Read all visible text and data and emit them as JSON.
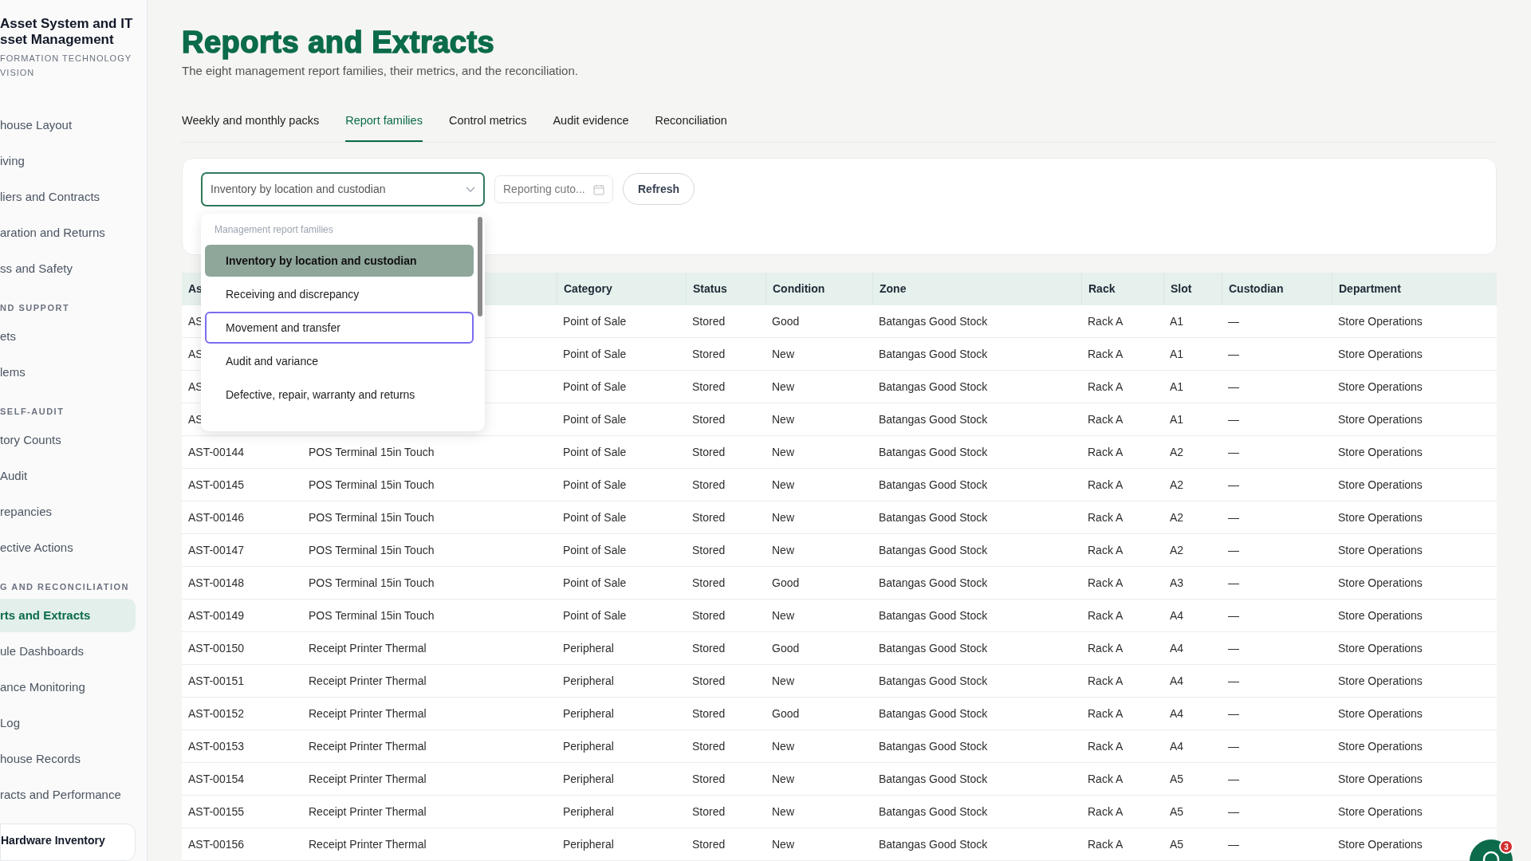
{
  "sidebar": {
    "brand_lines": [
      "Asset System and IT",
      "sset Management"
    ],
    "subtitle_lines": [
      "FORMATION TECHNOLOGY",
      "VISION"
    ],
    "sections": [
      {
        "items": [
          {
            "label": "house Layout",
            "selected": false
          },
          {
            "label": "iving",
            "selected": false
          },
          {
            "label": "liers and Contracts",
            "selected": false
          },
          {
            "label": "aration and Returns",
            "selected": false
          },
          {
            "label": "ss and Safety",
            "selected": false
          }
        ]
      },
      {
        "title": "ND SUPPORT",
        "items": [
          {
            "label": "ets",
            "selected": false
          },
          {
            "label": "lems",
            "selected": false
          }
        ]
      },
      {
        "title": "SELF-AUDIT",
        "items": [
          {
            "label": "tory Counts",
            "selected": false
          },
          {
            "label": "Audit",
            "selected": false
          },
          {
            "label": "repancies",
            "selected": false
          },
          {
            "label": "ective Actions",
            "selected": false
          }
        ]
      },
      {
        "title": "G AND RECONCILIATION",
        "items": [
          {
            "label": "rts and Extracts",
            "selected": true
          },
          {
            "label": "ule Dashboards",
            "selected": false
          },
          {
            "label": "ance Monitoring",
            "selected": false
          },
          {
            "label": "Log",
            "selected": false
          },
          {
            "label": "house Records",
            "selected": false
          },
          {
            "label": "racts and Performance",
            "selected": false
          }
        ]
      }
    ],
    "user_card": {
      "name": "Hardware Inventory"
    }
  },
  "page": {
    "title": "Reports and Extracts",
    "subtitle": "The eight management report families, their metrics, and the reconciliation."
  },
  "tabs": [
    {
      "label": "Weekly and monthly packs",
      "selected": false
    },
    {
      "label": "Report families",
      "selected": true
    },
    {
      "label": "Control metrics",
      "selected": false
    },
    {
      "label": "Audit evidence",
      "selected": false
    },
    {
      "label": "Reconciliation",
      "selected": false
    }
  ],
  "filters": {
    "family_select": {
      "value": "Inventory by location and custodian",
      "open": true
    },
    "date_field": {
      "placeholder": "Reporting cuto..."
    },
    "refresh_button": "Refresh"
  },
  "dropdown": {
    "group_label": "Management report families",
    "options": [
      {
        "label": "Inventory by location and custodian",
        "selected": true,
        "focused": false
      },
      {
        "label": "Receiving and discrepancy",
        "selected": false,
        "focused": false
      },
      {
        "label": "Movement and transfer",
        "selected": false,
        "focused": true
      },
      {
        "label": "Audit and variance",
        "selected": false,
        "focused": false
      },
      {
        "label": "Defective, repair, warranty and returns",
        "selected": false,
        "focused": false
      }
    ]
  },
  "table": {
    "columns": [
      "As",
      "Category",
      "Status",
      "Condition",
      "Zone",
      "Rack",
      "Slot",
      "Custodian",
      "Department"
    ],
    "rows": [
      {
        "asset_id": "AS",
        "category": "Point of Sale",
        "status": "Stored",
        "condition": "Good",
        "zone": "Batangas Good Stock",
        "rack": "Rack A",
        "slot": "A1",
        "custodian": "—",
        "department": "Store Operations"
      },
      {
        "asset_id": "AS",
        "category": "Point of Sale",
        "status": "Stored",
        "condition": "New",
        "zone": "Batangas Good Stock",
        "rack": "Rack A",
        "slot": "A1",
        "custodian": "—",
        "department": "Store Operations"
      },
      {
        "asset_id": "AS",
        "category": "Point of Sale",
        "status": "Stored",
        "condition": "New",
        "zone": "Batangas Good Stock",
        "rack": "Rack A",
        "slot": "A1",
        "custodian": "—",
        "department": "Store Operations"
      },
      {
        "asset_id": "AS",
        "category": "Point of Sale",
        "status": "Stored",
        "condition": "New",
        "zone": "Batangas Good Stock",
        "rack": "Rack A",
        "slot": "A1",
        "custodian": "—",
        "department": "Store Operations"
      },
      {
        "asset_id": "AST-00144",
        "name": "POS Terminal 15in Touch",
        "category": "Point of Sale",
        "status": "Stored",
        "condition": "New",
        "zone": "Batangas Good Stock",
        "rack": "Rack A",
        "slot": "A2",
        "custodian": "—",
        "department": "Store Operations"
      },
      {
        "asset_id": "AST-00145",
        "name": "POS Terminal 15in Touch",
        "category": "Point of Sale",
        "status": "Stored",
        "condition": "New",
        "zone": "Batangas Good Stock",
        "rack": "Rack A",
        "slot": "A2",
        "custodian": "—",
        "department": "Store Operations"
      },
      {
        "asset_id": "AST-00146",
        "name": "POS Terminal 15in Touch",
        "category": "Point of Sale",
        "status": "Stored",
        "condition": "New",
        "zone": "Batangas Good Stock",
        "rack": "Rack A",
        "slot": "A2",
        "custodian": "—",
        "department": "Store Operations"
      },
      {
        "asset_id": "AST-00147",
        "name": "POS Terminal 15in Touch",
        "category": "Point of Sale",
        "status": "Stored",
        "condition": "New",
        "zone": "Batangas Good Stock",
        "rack": "Rack A",
        "slot": "A2",
        "custodian": "—",
        "department": "Store Operations"
      },
      {
        "asset_id": "AST-00148",
        "name": "POS Terminal 15in Touch",
        "category": "Point of Sale",
        "status": "Stored",
        "condition": "Good",
        "zone": "Batangas Good Stock",
        "rack": "Rack A",
        "slot": "A3",
        "custodian": "—",
        "department": "Store Operations"
      },
      {
        "asset_id": "AST-00149",
        "name": "POS Terminal 15in Touch",
        "category": "Point of Sale",
        "status": "Stored",
        "condition": "New",
        "zone": "Batangas Good Stock",
        "rack": "Rack A",
        "slot": "A4",
        "custodian": "—",
        "department": "Store Operations"
      },
      {
        "asset_id": "AST-00150",
        "name": "Receipt Printer Thermal",
        "category": "Peripheral",
        "status": "Stored",
        "condition": "Good",
        "zone": "Batangas Good Stock",
        "rack": "Rack A",
        "slot": "A4",
        "custodian": "—",
        "department": "Store Operations"
      },
      {
        "asset_id": "AST-00151",
        "name": "Receipt Printer Thermal",
        "category": "Peripheral",
        "status": "Stored",
        "condition": "New",
        "zone": "Batangas Good Stock",
        "rack": "Rack A",
        "slot": "A4",
        "custodian": "—",
        "department": "Store Operations"
      },
      {
        "asset_id": "AST-00152",
        "name": "Receipt Printer Thermal",
        "category": "Peripheral",
        "status": "Stored",
        "condition": "Good",
        "zone": "Batangas Good Stock",
        "rack": "Rack A",
        "slot": "A4",
        "custodian": "—",
        "department": "Store Operations"
      },
      {
        "asset_id": "AST-00153",
        "name": "Receipt Printer Thermal",
        "category": "Peripheral",
        "status": "Stored",
        "condition": "New",
        "zone": "Batangas Good Stock",
        "rack": "Rack A",
        "slot": "A4",
        "custodian": "—",
        "department": "Store Operations"
      },
      {
        "asset_id": "AST-00154",
        "name": "Receipt Printer Thermal",
        "category": "Peripheral",
        "status": "Stored",
        "condition": "New",
        "zone": "Batangas Good Stock",
        "rack": "Rack A",
        "slot": "A5",
        "custodian": "—",
        "department": "Store Operations"
      },
      {
        "asset_id": "AST-00155",
        "name": "Receipt Printer Thermal",
        "category": "Peripheral",
        "status": "Stored",
        "condition": "New",
        "zone": "Batangas Good Stock",
        "rack": "Rack A",
        "slot": "A5",
        "custodian": "—",
        "department": "Store Operations"
      },
      {
        "asset_id": "AST-00156",
        "name": "Receipt Printer Thermal",
        "category": "Peripheral",
        "status": "Stored",
        "condition": "New",
        "zone": "Batangas Good Stock",
        "rack": "Rack A",
        "slot": "A5",
        "custodian": "—",
        "department": "Store Operations"
      }
    ]
  },
  "chat_button": {
    "badge": "3"
  }
}
